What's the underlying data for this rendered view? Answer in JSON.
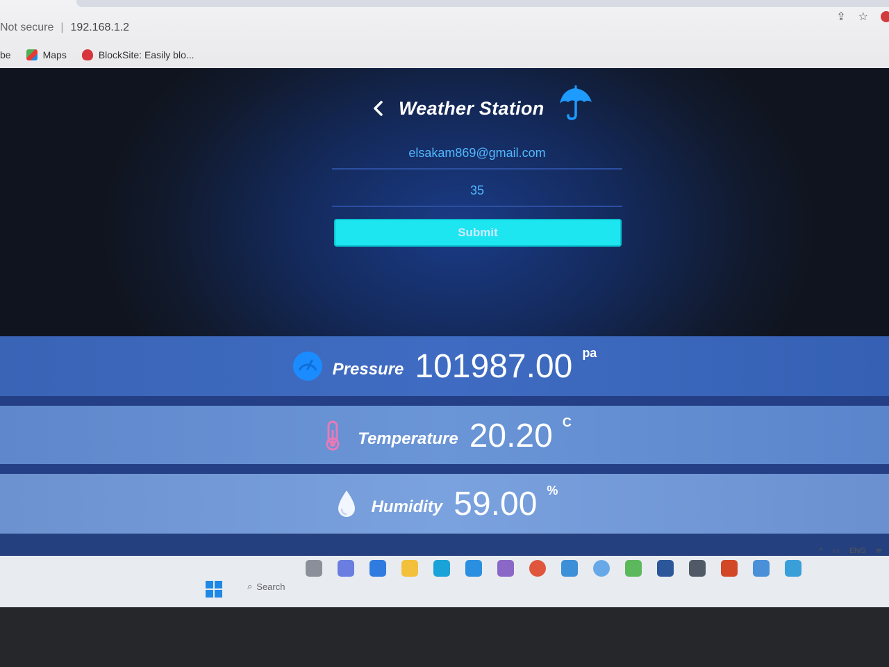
{
  "browser": {
    "security_label": "Not secure",
    "url": "192.168.1.2",
    "bookmarks": [
      {
        "label": "be"
      },
      {
        "label": "Maps"
      },
      {
        "label": "BlockSite: Easily blo..."
      }
    ]
  },
  "app": {
    "title": "Weather Station",
    "email": "elsakam869@gmail.com",
    "number_value": "35",
    "submit_label": "Submit"
  },
  "readings": {
    "pressure": {
      "label": "Pressure",
      "value": "101987.00",
      "unit": "pa",
      "icon": "gauge-icon",
      "color": "#1a8cff"
    },
    "temperature": {
      "label": "Temperature",
      "value": "20.20",
      "unit": "C",
      "icon": "thermometer-icon",
      "color": "#e87ab8"
    },
    "humidity": {
      "label": "Humidity",
      "value": "59.00",
      "unit": "%",
      "icon": "water-drop-icon",
      "color": "#f2f6ff"
    }
  },
  "taskbar": {
    "search_label": "Search",
    "tray_language": "ENG"
  },
  "colors": {
    "accent_cyan": "#1ee6f0",
    "input_text": "#52b8ff",
    "umbrella": "#1e9bff"
  }
}
